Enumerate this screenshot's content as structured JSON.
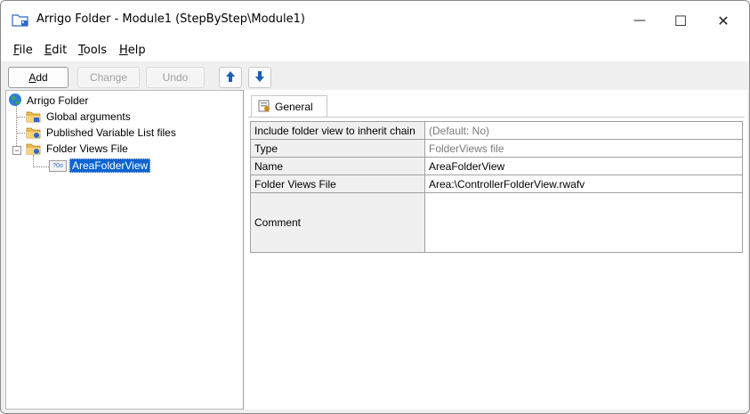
{
  "window": {
    "title": "Arrigo Folder - Module1 (StepByStep\\Module1)",
    "minimize_glyph": "—",
    "maximize_glyph": "☐",
    "close_glyph": "✕"
  },
  "menu": [
    {
      "key": "F",
      "rest": "ile"
    },
    {
      "key": "E",
      "rest": "dit"
    },
    {
      "key": "T",
      "rest": "ools"
    },
    {
      "key": "H",
      "rest": "elp"
    }
  ],
  "toolbar": {
    "add_key": "A",
    "add_rest": "dd",
    "change_label": "Change",
    "undo_label": "Undo"
  },
  "tree": {
    "root": "Arrigo Folder",
    "items": [
      "Global arguments",
      "Published Variable List files",
      "Folder Views File"
    ],
    "child_selected": "AreaFolderView",
    "child_badge": "?0o"
  },
  "tabs": {
    "general_label": "General"
  },
  "properties": [
    {
      "key": "Include folder view to inherit chain",
      "value": "(Default: No)"
    },
    {
      "key": "Type",
      "value": "FolderViews file"
    },
    {
      "key": "Name",
      "value": "AreaFolderView"
    },
    {
      "key": "Folder Views File",
      "value": "Area:\\ControllerFolderView.rwafv"
    },
    {
      "key": "Comment",
      "value": ""
    }
  ],
  "colors": {
    "selection": "#0a64d2",
    "folder": "#e9b94a",
    "arrow": "#1a5fb4"
  }
}
